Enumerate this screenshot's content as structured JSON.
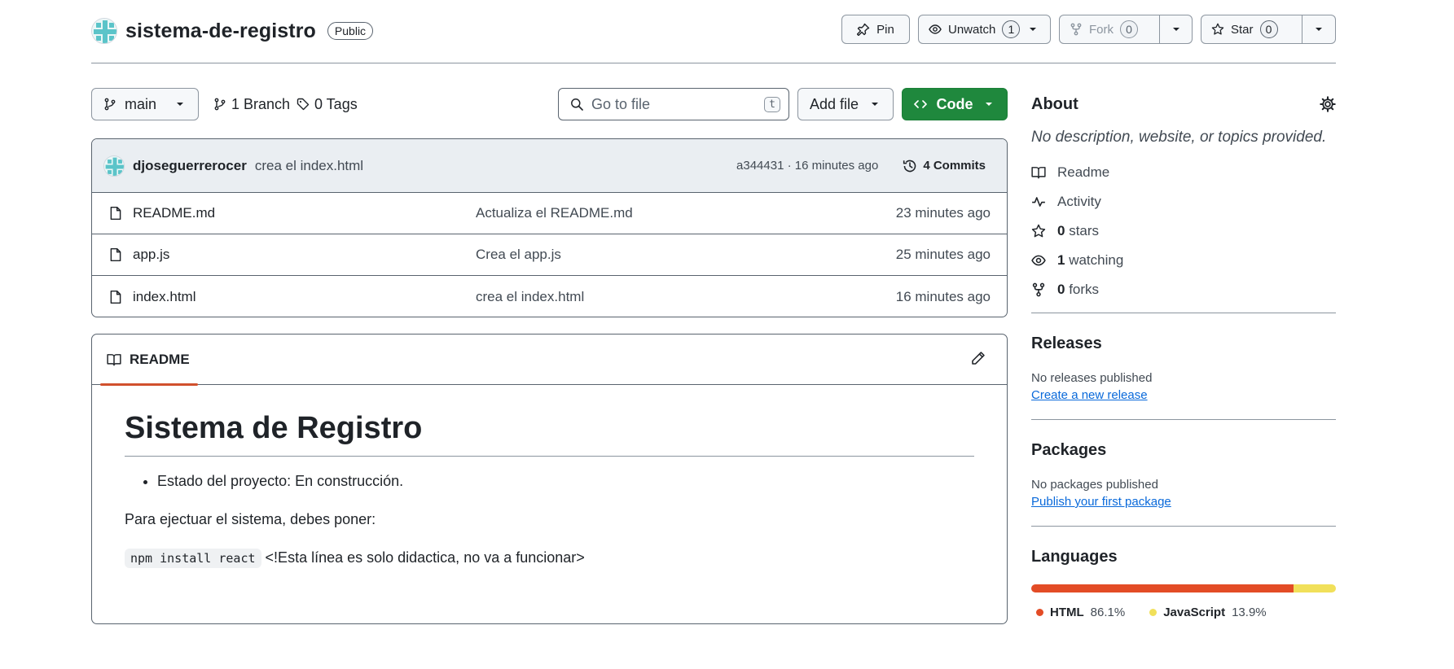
{
  "repo": {
    "name": "sistema-de-registro",
    "visibility": "Public",
    "actions": {
      "pin": "Pin",
      "unwatch": "Unwatch",
      "watch_count": "1",
      "fork": "Fork",
      "fork_count": "0",
      "star": "Star",
      "star_count": "0"
    }
  },
  "toolbar": {
    "branch": "main",
    "branches": "1 Branch",
    "tags": "0 Tags",
    "goto_placeholder": "Go to file",
    "goto_shortcut": "t",
    "add_file": "Add file",
    "code": "Code"
  },
  "latest_commit": {
    "author": "djoseguerrerocer",
    "message": "crea el index.html",
    "sha_time": "a344431 · 16 minutes ago",
    "commits": "4 Commits"
  },
  "files": [
    {
      "name": "README.md",
      "message": "Actualiza el README.md",
      "time": "23 minutes ago",
      "icon": "file-icon"
    },
    {
      "name": "app.js",
      "message": "Crea el app.js",
      "time": "25 minutes ago",
      "icon": "file-icon"
    },
    {
      "name": "index.html",
      "message": "crea el index.html",
      "time": "16 minutes ago",
      "icon": "file-icon"
    }
  ],
  "readme": {
    "tab": "README",
    "heading": "Sistema de Registro",
    "bullet": "Estado del proyecto: En construcción.",
    "paragraph": "Para ejectuar el sistema, debes poner:",
    "code": "npm install react",
    "code_note": "<!Esta línea es solo didactica, no va a funcionar>"
  },
  "about": {
    "title": "About",
    "description": "No description, website, or topics provided.",
    "readme": "Readme",
    "activity": "Activity",
    "stars_count": "0",
    "stars_label": "stars",
    "watching_count": "1",
    "watching_label": "watching",
    "forks_count": "0",
    "forks_label": "forks"
  },
  "releases": {
    "title": "Releases",
    "status": "No releases published",
    "link": "Create a new release"
  },
  "packages": {
    "title": "Packages",
    "status": "No packages published",
    "link": "Publish your first package"
  },
  "languages": {
    "title": "Languages",
    "items": [
      {
        "name": "HTML",
        "percent": "86.1%",
        "value": 86.1,
        "color": "#e34c26"
      },
      {
        "name": "JavaScript",
        "percent": "13.9%",
        "value": 13.9,
        "color": "#f1e05a"
      }
    ]
  },
  "colors": {
    "accent_green": "#1f883d",
    "link": "#0969da",
    "tab_underline": "#d1502d"
  }
}
